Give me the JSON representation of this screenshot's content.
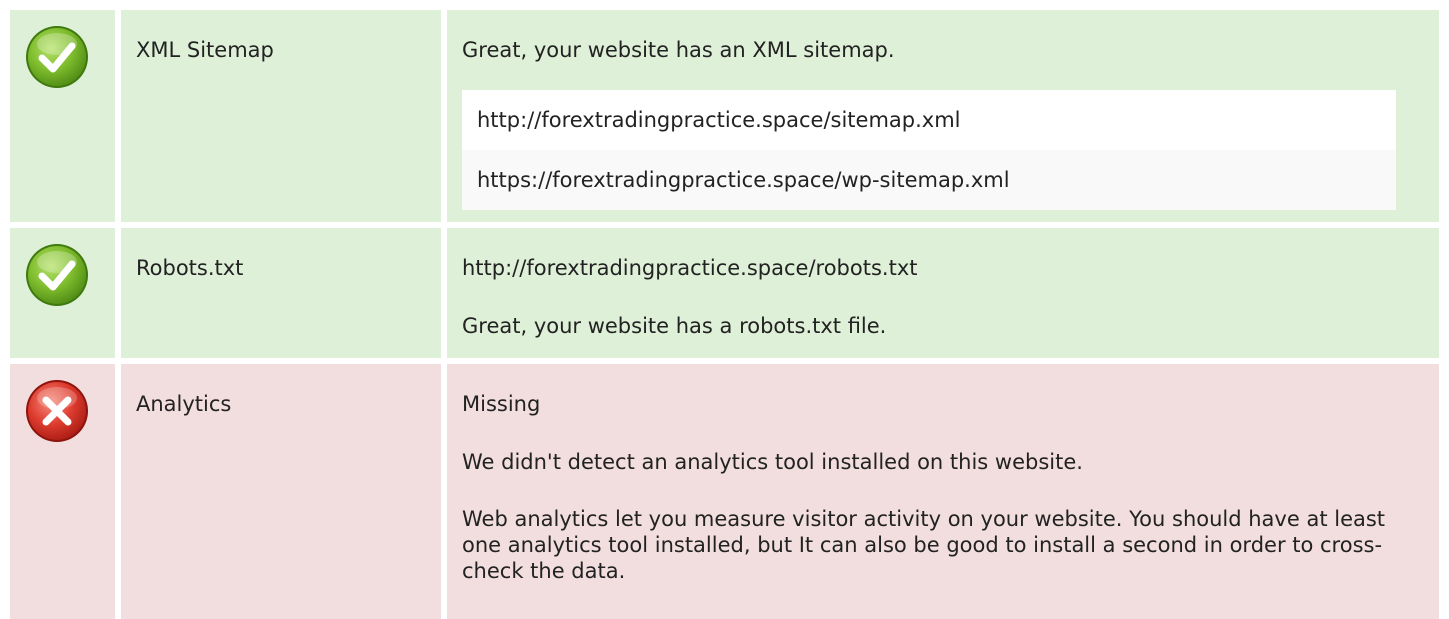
{
  "checks": [
    {
      "id": "sitemap",
      "status": "pass",
      "icon": "check-icon",
      "label": "XML Sitemap",
      "message": "Great, your website has an XML sitemap.",
      "urls": [
        "http://forextradingpractice.space/sitemap.xml",
        "https://forextradingpractice.space/wp-sitemap.xml"
      ]
    },
    {
      "id": "robots",
      "status": "pass",
      "icon": "check-icon",
      "label": "Robots.txt",
      "url": "http://forextradingpractice.space/robots.txt",
      "message": "Great, your website has a robots.txt file."
    },
    {
      "id": "analytics",
      "status": "fail",
      "icon": "cross-icon",
      "label": "Analytics",
      "status_text": "Missing",
      "message": "We didn't detect an analytics tool installed on this website.",
      "detail": "Web analytics let you measure visitor activity on your website. You should have at least one analytics tool installed, but It can also be good to install a second in order to cross-check the data."
    }
  ],
  "colors": {
    "pass_background": "#dff0d8",
    "fail_background": "#f2dede",
    "pass_icon": "#6aa82a",
    "fail_icon": "#d9302a"
  }
}
